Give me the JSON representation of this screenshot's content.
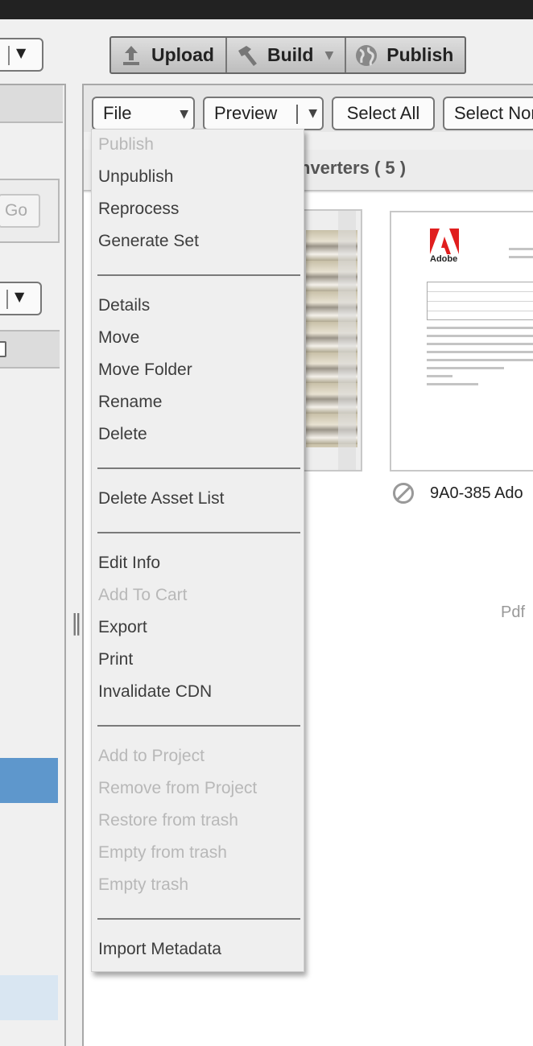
{
  "toolbar": {
    "upload": "Upload",
    "build": "Build",
    "publish": "Publish"
  },
  "left_pane": {
    "go_label": "Go"
  },
  "action_bar": {
    "file": "File",
    "preview": "Preview",
    "select_all": "Select All",
    "select_none": "Select Nor"
  },
  "folder_title": "nverters ( 5 )",
  "assets": [
    {
      "name": "9A0-385 Ado",
      "type": "Pdf",
      "logo_text": "Adobe"
    }
  ],
  "file_menu": {
    "groups": [
      [
        {
          "label": "Publish",
          "enabled": false
        },
        {
          "label": "Unpublish",
          "enabled": true
        },
        {
          "label": "Reprocess",
          "enabled": true
        },
        {
          "label": "Generate Set",
          "enabled": true
        }
      ],
      [
        {
          "label": "Details",
          "enabled": true
        },
        {
          "label": "Move",
          "enabled": true
        },
        {
          "label": "Move Folder",
          "enabled": true
        },
        {
          "label": "Rename",
          "enabled": true
        },
        {
          "label": "Delete",
          "enabled": true
        }
      ],
      [
        {
          "label": "Delete Asset List",
          "enabled": true
        }
      ],
      [
        {
          "label": "Edit Info",
          "enabled": true
        },
        {
          "label": "Add To Cart",
          "enabled": false
        },
        {
          "label": "Export",
          "enabled": true
        },
        {
          "label": "Print",
          "enabled": true
        },
        {
          "label": "Invalidate CDN",
          "enabled": true
        }
      ],
      [
        {
          "label": "Add to Project",
          "enabled": false
        },
        {
          "label": "Remove from Project",
          "enabled": false
        },
        {
          "label": "Restore from trash",
          "enabled": false
        },
        {
          "label": "Empty from trash",
          "enabled": false
        },
        {
          "label": "Empty trash",
          "enabled": false
        }
      ],
      [
        {
          "label": "Import Metadata",
          "enabled": true
        }
      ]
    ]
  },
  "colors": {
    "selected_row": "#5e97cc",
    "highlight_row": "#d9e6f2",
    "disabled_text": "#b8b8b8"
  }
}
